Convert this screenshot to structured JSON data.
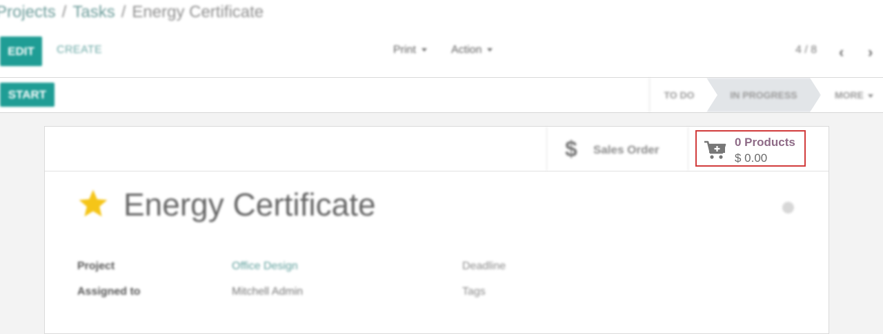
{
  "breadcrumb": {
    "items": [
      "Projects",
      "Tasks",
      "Energy Certificate"
    ],
    "separator": "/"
  },
  "toolbar": {
    "edit_label": "EDIT",
    "create_label": "CREATE",
    "print_label": "Print",
    "action_label": "Action",
    "pager": "4 / 8"
  },
  "status": {
    "start_label": "START",
    "stages": [
      "TO DO",
      "IN PROGRESS",
      "MORE"
    ],
    "active_stage": "IN PROGRESS"
  },
  "smart_buttons": {
    "sales_order_label": "Sales Order",
    "products_count": "0 Products",
    "products_amount": "$ 0.00"
  },
  "task": {
    "title": "Energy Certificate",
    "starred": true
  },
  "fields": {
    "project_label": "Project",
    "project_value": "Office Design",
    "assigned_label": "Assigned to",
    "assigned_value": "Mitchell Admin",
    "deadline_label": "Deadline",
    "tags_label": "Tags"
  },
  "icons": {
    "cart": "cart-plus-icon",
    "dollar": "dollar-icon",
    "star": "star-icon"
  },
  "colors": {
    "primary": "#1f9d95",
    "highlight_border": "#d13b3b",
    "products_text": "#8e6b87",
    "star": "#f5c518"
  }
}
